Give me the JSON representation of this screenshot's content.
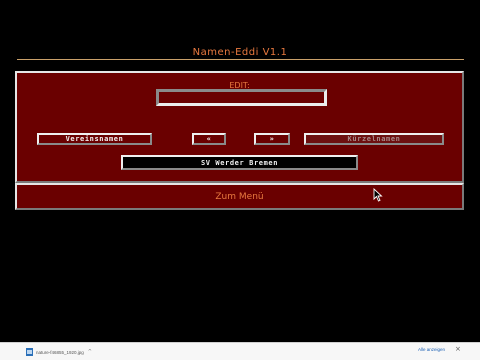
{
  "app": {
    "title": "Namen-Eddi V1.1"
  },
  "editor": {
    "edit_label": "EDIT:",
    "edit_value": "",
    "clubnames_button": "Vereinsnamen",
    "prev_button": "«",
    "next_button": "»",
    "abbreviations_button": "Kürzelnamen",
    "current_name": "SV Werder Bremen"
  },
  "menu": {
    "back_label": "Zum Menü"
  },
  "downloads": {
    "file_name": "nature-f46855_1920.jpg",
    "chevron": "^",
    "show_all": "Alle anzeigen",
    "close": "×"
  },
  "colors": {
    "panel": "#6a0000",
    "accent": "#e8793f",
    "background": "#000000"
  }
}
